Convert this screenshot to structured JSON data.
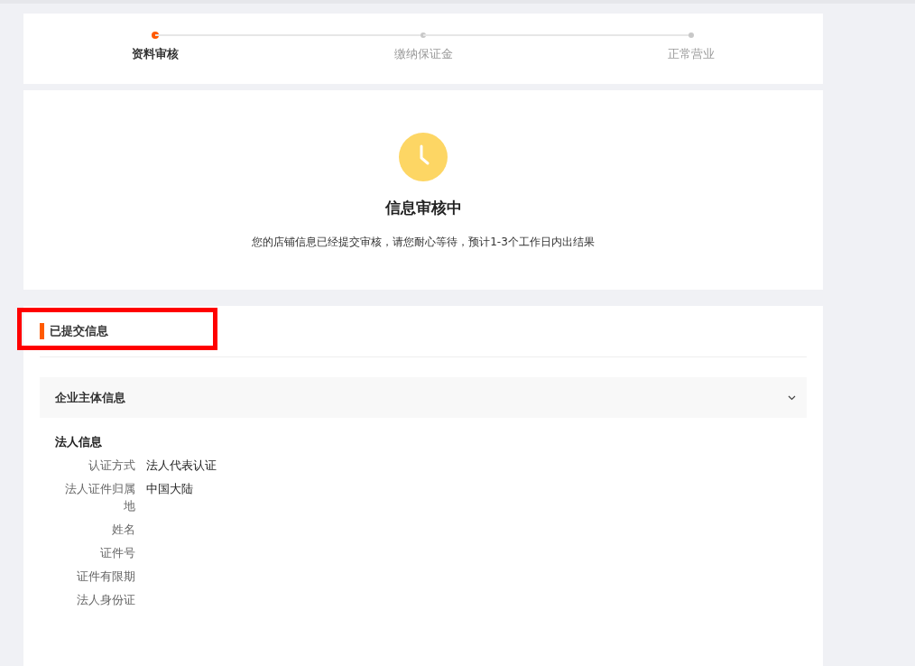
{
  "steps": [
    {
      "label": "资料审核",
      "selected": true
    },
    {
      "label": "缴纳保证金",
      "selected": false
    },
    {
      "label": "正常营业",
      "selected": false
    }
  ],
  "status": {
    "title": "信息审核中",
    "message": "您的店铺信息已经提交审核，请您耐心等待，预计1-3个工作日内出结果"
  },
  "submitted": {
    "title": "已提交信息",
    "highlighted": true,
    "panel": {
      "title": "企业主体信息",
      "expanded": true
    },
    "group_title": "法人信息",
    "fields": [
      {
        "label": "认证方式",
        "value": "法人代表认证"
      },
      {
        "label": "法人证件归属地",
        "value": "中国大陆"
      },
      {
        "label": "姓名"
      },
      {
        "label": "证件号"
      },
      {
        "label": "证件有限期"
      },
      {
        "label": "法人身份证"
      }
    ]
  }
}
